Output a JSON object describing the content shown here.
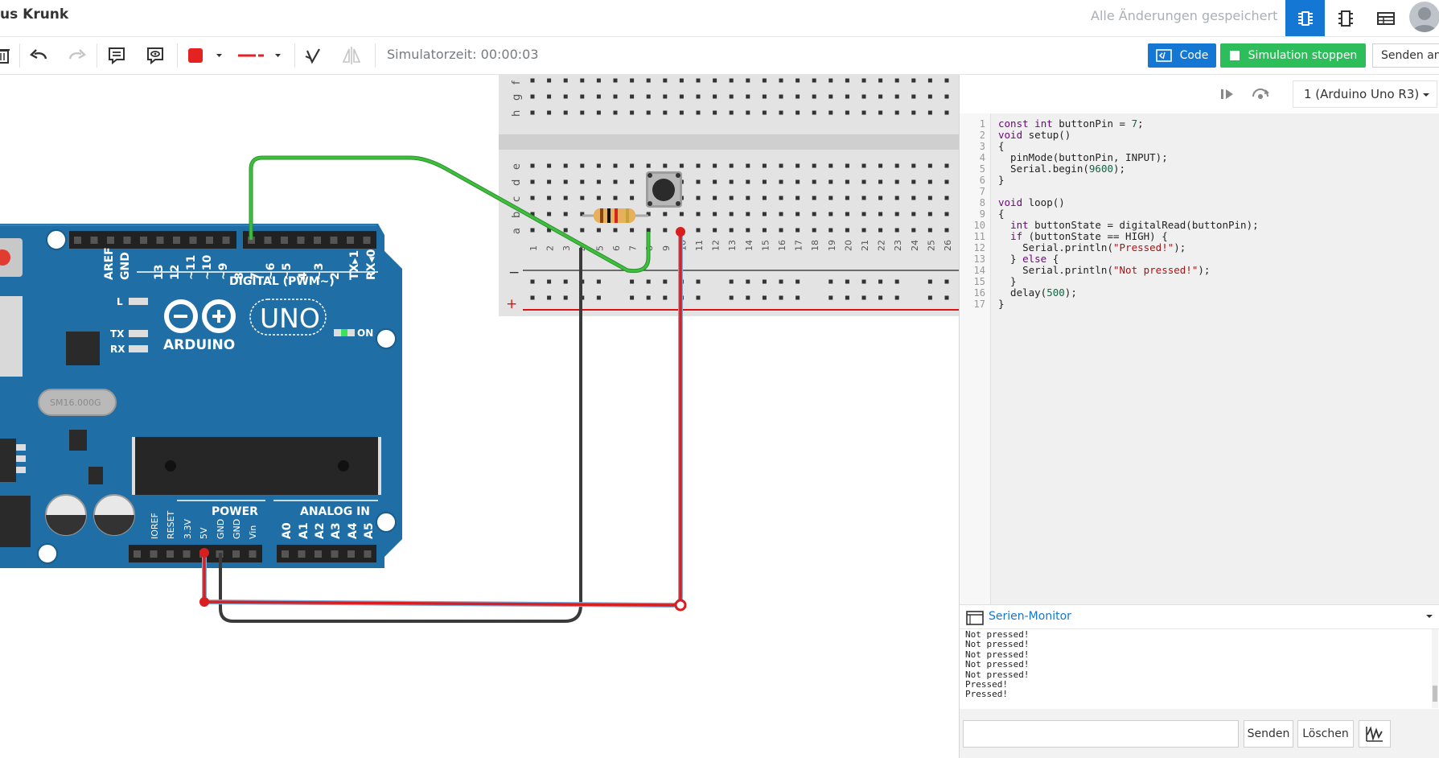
{
  "header": {
    "title": "us Krunk",
    "status": "Alle Änderungen gespeichert",
    "view_buttons": [
      "circuit-view-icon",
      "schematic-view-icon",
      "component-list-icon"
    ]
  },
  "toolbar": {
    "sim_time": "Simulatorzeit: 00:00:03",
    "code_label": "Code",
    "sim_label": "Simulation stoppen",
    "send_label": "Senden an",
    "wire_color": "#e52222"
  },
  "breadboard": {
    "top_rows": [
      "f",
      "g",
      "h"
    ],
    "mid_rows": [
      "a",
      "b",
      "c",
      "d",
      "e"
    ],
    "columns": [
      "1",
      "2",
      "3",
      "4",
      "5",
      "6",
      "7",
      "8",
      "9",
      "10",
      "11",
      "12",
      "13",
      "14",
      "15",
      "16",
      "17",
      "18",
      "19",
      "20",
      "21",
      "22",
      "23",
      "24",
      "25",
      "26"
    ],
    "minus": "−",
    "plus": "+"
  },
  "arduino": {
    "digital_label": "DIGITAL (PWM∼)",
    "brand": "ARDUINO",
    "model": "UNO",
    "on_label": "ON",
    "l_label": "L",
    "tx_label": "TX",
    "rx_label": "RX",
    "crystal": "SM16.000G",
    "power_label": "POWER",
    "analog_label": "ANALOG IN",
    "digital_pins": [
      "AREF",
      "GND",
      "13",
      "12",
      "~11",
      "~10",
      "~9",
      "8",
      "7",
      "~6",
      "~5",
      "4",
      "~3",
      "2",
      "TX▸1",
      "RX◂0"
    ],
    "power_pins": [
      "IOREF",
      "RESET",
      "3.3V",
      "5V",
      "GND",
      "GND",
      "Vin"
    ],
    "analog_pins": [
      "A0",
      "A1",
      "A2",
      "A3",
      "A4",
      "A5"
    ]
  },
  "panel": {
    "device_select": "1 (Arduino Uno R3)",
    "code_lines": [
      "const int buttonPin = 7;",
      "void setup()",
      "{",
      "  pinMode(buttonPin, INPUT);",
      "  Serial.begin(9600);",
      "}",
      "",
      "void loop()",
      "{",
      "  int buttonState = digitalRead(buttonPin);",
      "  if (buttonState == HIGH) {",
      "    Serial.println(\"Pressed!\");",
      "  } else {",
      "    Serial.println(\"Not pressed!\");",
      "  }",
      "  delay(500);",
      "}"
    ],
    "line_numbers": [
      "1",
      "2",
      "3",
      "4",
      "5",
      "6",
      "7",
      "8",
      "9",
      "10",
      "11",
      "12",
      "13",
      "14",
      "15",
      "16",
      "17"
    ],
    "serial_title": "Serien-Monitor",
    "serial_lines": [
      "Not pressed!",
      "Not pressed!",
      "Not pressed!",
      "Not pressed!",
      "Not pressed!",
      "Pressed!",
      "Pressed!"
    ],
    "send_button": "Senden",
    "clear_button": "Löschen"
  }
}
